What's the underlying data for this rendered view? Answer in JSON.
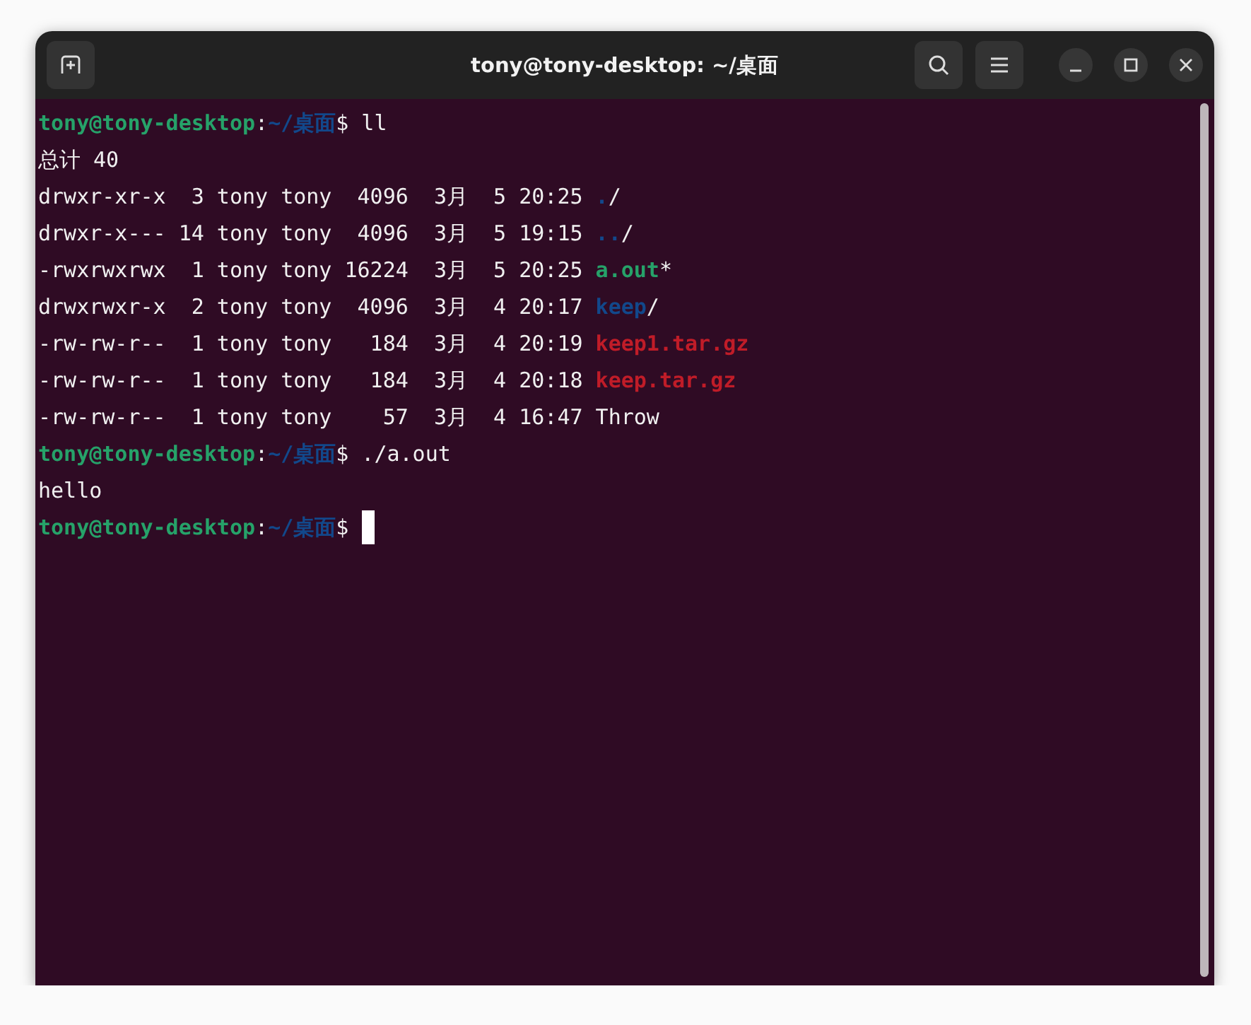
{
  "window": {
    "title": "tony@tony-desktop: ~/桌面"
  },
  "terminal": {
    "lines": [
      {
        "cursor": false,
        "segments": [
          {
            "kind": "user",
            "text": "tony@tony-desktop"
          },
          {
            "kind": "plain",
            "text": ":"
          },
          {
            "kind": "path",
            "text": "~/桌面"
          },
          {
            "kind": "plain",
            "text": "$ ll"
          }
        ]
      },
      {
        "cursor": false,
        "segments": [
          {
            "kind": "plain",
            "text": "总计 40"
          }
        ]
      },
      {
        "cursor": false,
        "segments": [
          {
            "kind": "plain",
            "text": "drwxr-xr-x  3 tony tony  4096  3月  5 20:25 "
          },
          {
            "kind": "dir",
            "text": "."
          },
          {
            "kind": "plain",
            "text": "/"
          }
        ]
      },
      {
        "cursor": false,
        "segments": [
          {
            "kind": "plain",
            "text": "drwxr-x--- 14 tony tony  4096  3月  5 19:15 "
          },
          {
            "kind": "dir",
            "text": ".."
          },
          {
            "kind": "plain",
            "text": "/"
          }
        ]
      },
      {
        "cursor": false,
        "segments": [
          {
            "kind": "plain",
            "text": "-rwxrwxrwx  1 tony tony 16224  3月  5 20:25 "
          },
          {
            "kind": "exec",
            "text": "a.out"
          },
          {
            "kind": "plain",
            "text": "*"
          }
        ]
      },
      {
        "cursor": false,
        "segments": [
          {
            "kind": "plain",
            "text": "drwxrwxr-x  2 tony tony  4096  3月  4 20:17 "
          },
          {
            "kind": "dir",
            "text": "keep"
          },
          {
            "kind": "plain",
            "text": "/"
          }
        ]
      },
      {
        "cursor": false,
        "segments": [
          {
            "kind": "plain",
            "text": "-rw-rw-r--  1 tony tony   184  3月  4 20:19 "
          },
          {
            "kind": "archive",
            "text": "keep1.tar.gz"
          }
        ]
      },
      {
        "cursor": false,
        "segments": [
          {
            "kind": "plain",
            "text": "-rw-rw-r--  1 tony tony   184  3月  4 20:18 "
          },
          {
            "kind": "archive",
            "text": "keep.tar.gz"
          }
        ]
      },
      {
        "cursor": false,
        "segments": [
          {
            "kind": "plain",
            "text": "-rw-rw-r--  1 tony tony    57  3月  4 16:47 Throw"
          }
        ]
      },
      {
        "cursor": false,
        "segments": [
          {
            "kind": "user",
            "text": "tony@tony-desktop"
          },
          {
            "kind": "plain",
            "text": ":"
          },
          {
            "kind": "path",
            "text": "~/桌面"
          },
          {
            "kind": "plain",
            "text": "$ ./a.out"
          }
        ]
      },
      {
        "cursor": false,
        "segments": [
          {
            "kind": "plain",
            "text": "hello"
          }
        ]
      },
      {
        "cursor": true,
        "segments": [
          {
            "kind": "user",
            "text": "tony@tony-desktop"
          },
          {
            "kind": "plain",
            "text": ":"
          },
          {
            "kind": "path",
            "text": "~/桌面"
          },
          {
            "kind": "plain",
            "text": "$ "
          }
        ]
      }
    ]
  }
}
